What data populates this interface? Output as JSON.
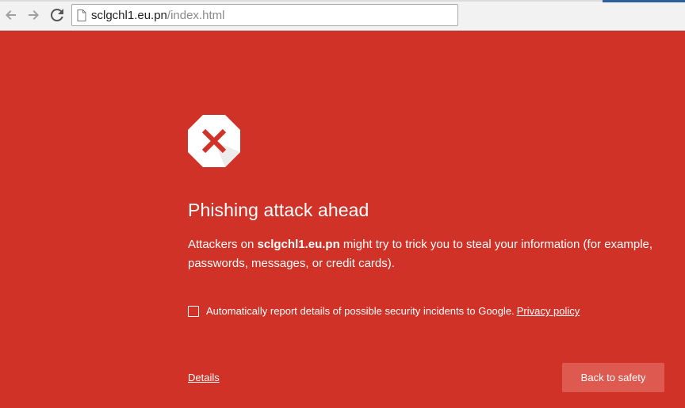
{
  "browser": {
    "url_host": "sclgchl1.eu.pn",
    "url_path": "/index.html",
    "back_icon": "arrow-left-icon",
    "forward_icon": "arrow-right-icon",
    "reload_icon": "reload-icon",
    "page_icon": "page-icon"
  },
  "interstitial": {
    "heading": "Phishing attack ahead",
    "explanation_prefix": "Attackers on ",
    "explanation_domain": "sclgchl1.eu.pn",
    "explanation_suffix": " might try to trick you to steal your information (for example, passwords, messages, or credit cards).",
    "report_label": "Automatically report details of possible security incidents to Google.",
    "privacy_link": "Privacy policy",
    "report_checked": false,
    "details_link": "Details",
    "back_button": "Back to safety",
    "warning_icon": "warning-cross-icon"
  },
  "colors": {
    "background": "#d03227",
    "button": "#de5a50",
    "icon_cross": "#d03227",
    "text": "#ffffff"
  }
}
